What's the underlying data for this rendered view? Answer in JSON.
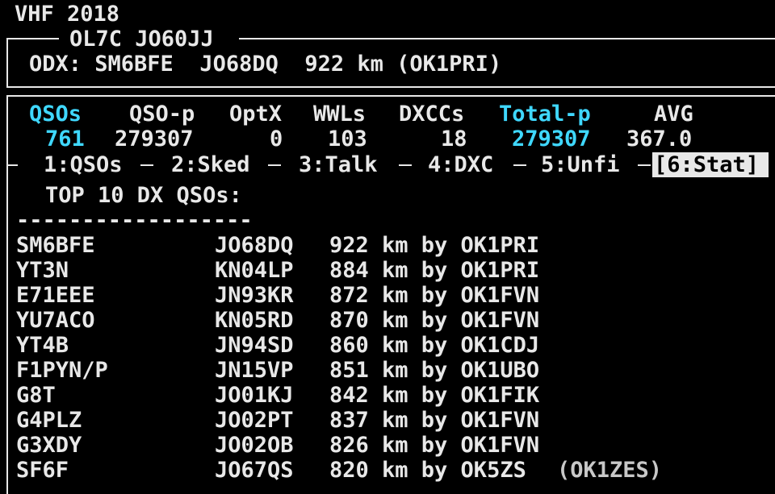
{
  "app": {
    "title": "VHF 2018"
  },
  "frame": {
    "station_title": "OL7C JO60JJ",
    "odx_line": "ODX: SM6BFE  JO68DQ  922 km (OK1PRI)"
  },
  "stats": {
    "headers": [
      "QSOs",
      "QSO-p",
      "OptX",
      "WWLs",
      "DXCCs",
      "Total-p",
      "AVG"
    ],
    "values": [
      "761",
      "279307",
      "0",
      "103",
      "18",
      "279307",
      "367.0"
    ]
  },
  "tabs": [
    {
      "label": "1:QSOs"
    },
    {
      "label": "2:Sked"
    },
    {
      "label": "3:Talk"
    },
    {
      "label": "4:DXC"
    },
    {
      "label": "5:Unfi"
    },
    {
      "label": "[6:Stat]"
    }
  ],
  "dx_list": {
    "heading": "TOP 10 DX QSOs:",
    "separator": "------------------",
    "rows": [
      {
        "call": "SM6BFE",
        "locator": "JO68DQ",
        "distance": "922 km by OK1PRI",
        "extra": ""
      },
      {
        "call": "YT3N",
        "locator": "KN04LP",
        "distance": "884 km by OK1PRI",
        "extra": ""
      },
      {
        "call": "E71EEE",
        "locator": "JN93KR",
        "distance": "872 km by OK1FVN",
        "extra": ""
      },
      {
        "call": "YU7ACO",
        "locator": "KN05RD",
        "distance": "870 km by OK1FVN",
        "extra": ""
      },
      {
        "call": "YT4B",
        "locator": "JN94SD",
        "distance": "860 km by OK1CDJ",
        "extra": ""
      },
      {
        "call": "F1PYN/P",
        "locator": "JN15VP",
        "distance": "851 km by OK1UBO",
        "extra": ""
      },
      {
        "call": "G8T",
        "locator": "JO01KJ",
        "distance": "842 km by OK1FIK",
        "extra": ""
      },
      {
        "call": "G4PLZ",
        "locator": "JO02PT",
        "distance": "837 km by OK1FVN",
        "extra": ""
      },
      {
        "call": "G3XDY",
        "locator": "JO02OB",
        "distance": "826 km by OK1FVN",
        "extra": ""
      },
      {
        "call": "SF6F",
        "locator": "JO67QS",
        "distance": "820 km by OK5ZS",
        "extra": "(OK1ZES)"
      }
    ]
  },
  "colors": {
    "background": "#000000",
    "text": "#e8e8e8",
    "highlight": "#3fd8ff"
  }
}
